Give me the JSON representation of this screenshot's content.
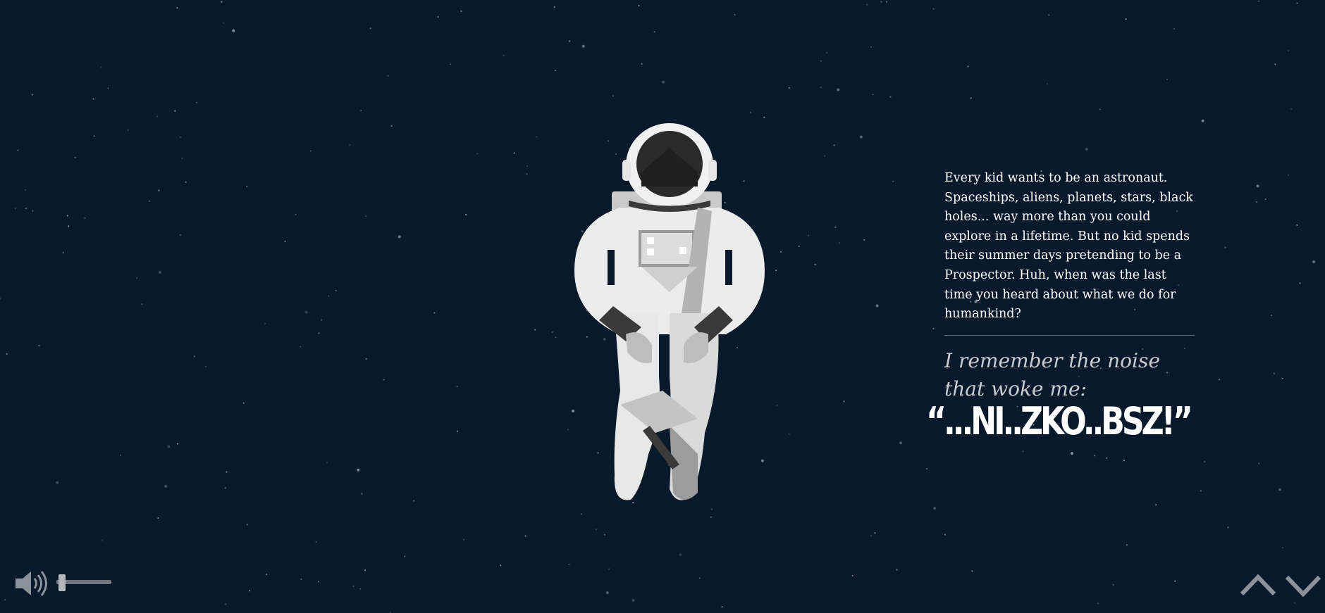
{
  "story": {
    "intro": "Every kid wants to be an astronaut. Spaceships, aliens, planets, stars, black holes... way more than you could explore in a lifetime. But no kid spends their summer days pretending to be a Prospector. Huh, when was the last time you heard about what we do for humankind?",
    "remember": "I remember the noise that woke me:",
    "noise": "“...NI..ZKO..BSZ!”"
  },
  "audio": {
    "icon": "speaker-volume-icon",
    "volume_level": 0.05
  },
  "navigation": {
    "up_icon": "chevron-up-icon",
    "down_icon": "chevron-down-icon"
  },
  "colors": {
    "background": "#08192b",
    "text": "#ffffff",
    "muted_text": "#c9ccd0",
    "controls": "#8a929b"
  }
}
